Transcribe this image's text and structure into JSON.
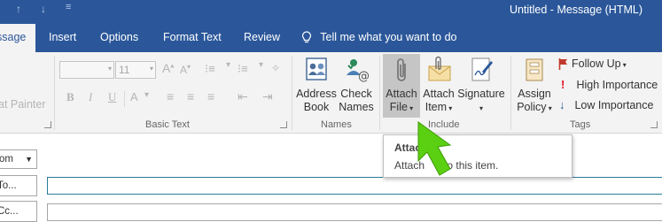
{
  "window": {
    "title": "Untitled - Message (HTML)"
  },
  "tabs": [
    {
      "label": "ssage",
      "active": true
    },
    {
      "label": "Insert"
    },
    {
      "label": "Options"
    },
    {
      "label": "Format Text"
    },
    {
      "label": "Review"
    }
  ],
  "tell_me": {
    "label": "Tell me what you want to do"
  },
  "clipboard": {
    "format_painter_label": "at Painter"
  },
  "basic_text": {
    "font_size": "11",
    "bold": "B",
    "italic": "I",
    "underline": "U",
    "font_color": "A",
    "group_label": "Basic Text"
  },
  "names": {
    "address_book": {
      "line1": "Address",
      "line2": "Book"
    },
    "check_names": {
      "line1": "Check",
      "line2": "Names"
    },
    "group_label": "Names"
  },
  "include": {
    "attach_file": {
      "line1": "Attach",
      "line2": "File"
    },
    "attach_item": {
      "line1": "Attach",
      "line2": "Item"
    },
    "signature": {
      "line1": "Signature"
    },
    "group_label": "Include"
  },
  "tags": {
    "assign_policy": {
      "line1": "Assign",
      "line2": "Policy"
    },
    "follow_up": "Follow Up",
    "high_importance": "High Importance",
    "low_importance": "Low Importance",
    "group_label": "Tags"
  },
  "message": {
    "from_label": "om",
    "to_label": "To...",
    "cc_label": "Cc..."
  },
  "tooltip": {
    "title": "Attac",
    "body_part1": "Attach",
    "body_part2": "to this item."
  },
  "colors": {
    "accent": "#2b579a",
    "ribbon_bg": "#f3f3f3",
    "arrow_green": "#5bd012",
    "flag_red": "#c0392b",
    "importance_red": "#e81123",
    "importance_blue": "#2b579a"
  }
}
